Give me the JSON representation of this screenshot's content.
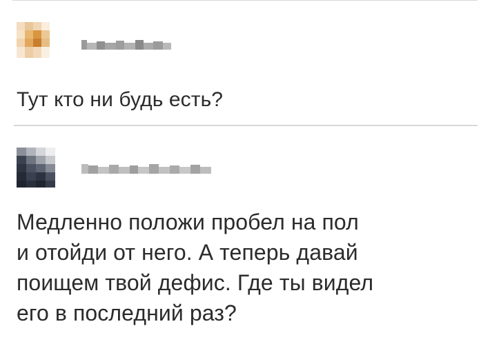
{
  "thread": {
    "comments": [
      {
        "username": "",
        "text_lines": [
          "Тут кто ни будь есть?"
        ]
      },
      {
        "username": "",
        "text_lines": [
          "Медленно положи пробел на пол",
          "и отойди от него. А теперь давай",
          "поищем твой дефис. Где ты видел",
          "его в последний раз?"
        ]
      }
    ]
  },
  "colors": {
    "text": "#2b2b2b",
    "separator": "#d7d7d7",
    "background": "#ffffff"
  },
  "icons": {
    "avatar_1": "blurred-avatar-icon",
    "avatar_2": "blurred-avatar-icon"
  }
}
